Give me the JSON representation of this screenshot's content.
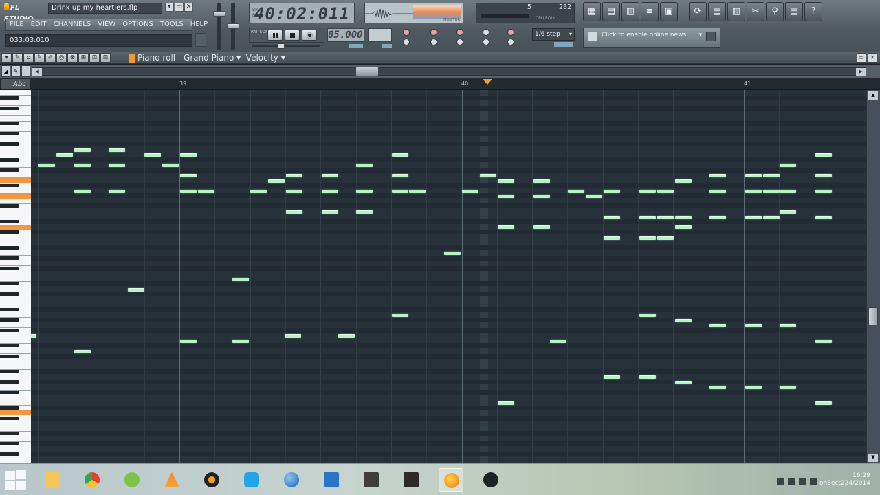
{
  "app": {
    "logo": "FL STUDIO",
    "song_title": "Drink up my heartiers.flp",
    "window_buttons": [
      "▾",
      "▭",
      "✕"
    ],
    "menu": [
      "FILE",
      "EDIT",
      "CHANNELS",
      "VIEW",
      "OPTIONS",
      "TOOLS",
      "HELP"
    ],
    "hint_bar": "033:03:010"
  },
  "transport": {
    "time_display": "40:02:011",
    "time_label_top": "BR",
    "time_label_bottom": "BT",
    "tempo": "85.000",
    "pat_song": "PAT SONG",
    "snap": "1/6 step",
    "cpu_value": "5",
    "poly_value": "282",
    "cpu_labels": "CPU  POLY",
    "ram_label": "RAM",
    "monitor_label": "MONITOR"
  },
  "browser_buttons": [
    "▦",
    "▤",
    "▥",
    "≡",
    "▣"
  ],
  "tool_buttons": [
    "⟳",
    "▤",
    "▥",
    "✂",
    "⚲",
    "▤",
    "?"
  ],
  "news": {
    "text": "Click to enable online news"
  },
  "piano_roll": {
    "header_icons": [
      "▾",
      "✎",
      "⌂",
      "✎",
      "✐",
      "◎",
      "⊗",
      "⊞",
      "⊡",
      "⊟"
    ],
    "title": "Piano roll - Grand Piano",
    "title_arrow": "▾",
    "velocity": "Velocity",
    "velocity_arrow": "▾",
    "right_buttons": [
      "▭",
      "✕"
    ],
    "abc_label": "Abc",
    "bar_numbers": [
      {
        "label": "39"
      },
      {
        "label": "40"
      },
      {
        "label": "41"
      }
    ]
  },
  "taskbar": {
    "apps": [
      "start",
      "file-explorer",
      "chrome",
      "utorrent",
      "vlc",
      "media-player",
      "skype",
      "google-earth",
      "visual-studio",
      "game-1",
      "game-2",
      "fl-studio",
      "obs"
    ],
    "clock_time": "16:29",
    "clock_date": "onSect224/2014"
  },
  "colors": {
    "note": "#b9f2c7",
    "grid_bg": "#27313a",
    "marker": "#f0a130",
    "highlight_key": "#f49640"
  }
}
